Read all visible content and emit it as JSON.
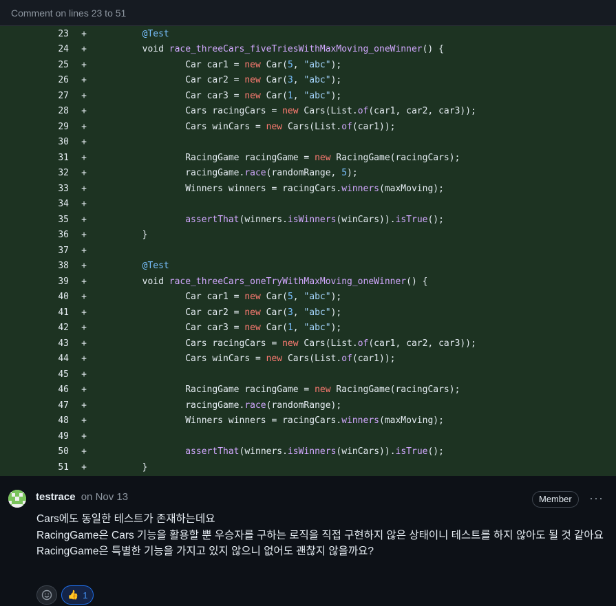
{
  "header": {
    "title": "Comment on lines 23 to 51"
  },
  "code": {
    "lines": [
      {
        "n": "23",
        "sign": "+",
        "tokens": [
          [
            "        ",
            ""
          ],
          [
            "@Test",
            "an"
          ]
        ]
      },
      {
        "n": "24",
        "sign": "+",
        "tokens": [
          [
            "        void ",
            ""
          ],
          [
            "race_threeCars_fiveTriesWithMaxMoving_oneWinner",
            "fn"
          ],
          [
            "() {",
            ""
          ]
        ]
      },
      {
        "n": "25",
        "sign": "+",
        "tokens": [
          [
            "                Car car1 = ",
            ""
          ],
          [
            "new",
            "kw"
          ],
          [
            " Car(",
            ""
          ],
          [
            "5",
            "num"
          ],
          [
            ", ",
            ""
          ],
          [
            "\"abc\"",
            "str"
          ],
          [
            ");",
            ""
          ]
        ]
      },
      {
        "n": "26",
        "sign": "+",
        "tokens": [
          [
            "                Car car2 = ",
            ""
          ],
          [
            "new",
            "kw"
          ],
          [
            " Car(",
            ""
          ],
          [
            "3",
            "num"
          ],
          [
            ", ",
            ""
          ],
          [
            "\"abc\"",
            "str"
          ],
          [
            ");",
            ""
          ]
        ]
      },
      {
        "n": "27",
        "sign": "+",
        "tokens": [
          [
            "                Car car3 = ",
            ""
          ],
          [
            "new",
            "kw"
          ],
          [
            " Car(",
            ""
          ],
          [
            "1",
            "num"
          ],
          [
            ", ",
            ""
          ],
          [
            "\"abc\"",
            "str"
          ],
          [
            ");",
            ""
          ]
        ]
      },
      {
        "n": "28",
        "sign": "+",
        "tokens": [
          [
            "                Cars racingCars = ",
            ""
          ],
          [
            "new",
            "kw"
          ],
          [
            " Cars(List.",
            ""
          ],
          [
            "of",
            "fn"
          ],
          [
            "(car1, car2, car3));",
            ""
          ]
        ]
      },
      {
        "n": "29",
        "sign": "+",
        "tokens": [
          [
            "                Cars winCars = ",
            ""
          ],
          [
            "new",
            "kw"
          ],
          [
            " Cars(List.",
            ""
          ],
          [
            "of",
            "fn"
          ],
          [
            "(car1));",
            ""
          ]
        ]
      },
      {
        "n": "30",
        "sign": "+",
        "tokens": []
      },
      {
        "n": "31",
        "sign": "+",
        "tokens": [
          [
            "                RacingGame racingGame = ",
            ""
          ],
          [
            "new",
            "kw"
          ],
          [
            " RacingGame(racingCars);",
            ""
          ]
        ]
      },
      {
        "n": "32",
        "sign": "+",
        "tokens": [
          [
            "                racingGame.",
            ""
          ],
          [
            "race",
            "fn"
          ],
          [
            "(randomRange, ",
            ""
          ],
          [
            "5",
            "num"
          ],
          [
            ");",
            ""
          ]
        ]
      },
      {
        "n": "33",
        "sign": "+",
        "tokens": [
          [
            "                Winners winners = racingCars.",
            ""
          ],
          [
            "winners",
            "fn"
          ],
          [
            "(maxMoving);",
            ""
          ]
        ]
      },
      {
        "n": "34",
        "sign": "+",
        "tokens": []
      },
      {
        "n": "35",
        "sign": "+",
        "tokens": [
          [
            "                ",
            ""
          ],
          [
            "assertThat",
            "fn"
          ],
          [
            "(winners.",
            ""
          ],
          [
            "isWinners",
            "fn"
          ],
          [
            "(winCars)).",
            ""
          ],
          [
            "isTrue",
            "fn"
          ],
          [
            "();",
            ""
          ]
        ]
      },
      {
        "n": "36",
        "sign": "+",
        "tokens": [
          [
            "        }",
            ""
          ]
        ]
      },
      {
        "n": "37",
        "sign": "+",
        "tokens": []
      },
      {
        "n": "38",
        "sign": "+",
        "tokens": [
          [
            "        ",
            ""
          ],
          [
            "@Test",
            "an"
          ]
        ]
      },
      {
        "n": "39",
        "sign": "+",
        "tokens": [
          [
            "        void ",
            ""
          ],
          [
            "race_threeCars_oneTryWithMaxMoving_oneWinner",
            "fn"
          ],
          [
            "() {",
            ""
          ]
        ]
      },
      {
        "n": "40",
        "sign": "+",
        "tokens": [
          [
            "                Car car1 = ",
            ""
          ],
          [
            "new",
            "kw"
          ],
          [
            " Car(",
            ""
          ],
          [
            "5",
            "num"
          ],
          [
            ", ",
            ""
          ],
          [
            "\"abc\"",
            "str"
          ],
          [
            ");",
            ""
          ]
        ]
      },
      {
        "n": "41",
        "sign": "+",
        "tokens": [
          [
            "                Car car2 = ",
            ""
          ],
          [
            "new",
            "kw"
          ],
          [
            " Car(",
            ""
          ],
          [
            "3",
            "num"
          ],
          [
            ", ",
            ""
          ],
          [
            "\"abc\"",
            "str"
          ],
          [
            ");",
            ""
          ]
        ]
      },
      {
        "n": "42",
        "sign": "+",
        "tokens": [
          [
            "                Car car3 = ",
            ""
          ],
          [
            "new",
            "kw"
          ],
          [
            " Car(",
            ""
          ],
          [
            "1",
            "num"
          ],
          [
            ", ",
            ""
          ],
          [
            "\"abc\"",
            "str"
          ],
          [
            ");",
            ""
          ]
        ]
      },
      {
        "n": "43",
        "sign": "+",
        "tokens": [
          [
            "                Cars racingCars = ",
            ""
          ],
          [
            "new",
            "kw"
          ],
          [
            " Cars(List.",
            ""
          ],
          [
            "of",
            "fn"
          ],
          [
            "(car1, car2, car3));",
            ""
          ]
        ]
      },
      {
        "n": "44",
        "sign": "+",
        "tokens": [
          [
            "                Cars winCars = ",
            ""
          ],
          [
            "new",
            "kw"
          ],
          [
            " Cars(List.",
            ""
          ],
          [
            "of",
            "fn"
          ],
          [
            "(car1));",
            ""
          ]
        ]
      },
      {
        "n": "45",
        "sign": "+",
        "tokens": []
      },
      {
        "n": "46",
        "sign": "+",
        "tokens": [
          [
            "                RacingGame racingGame = ",
            ""
          ],
          [
            "new",
            "kw"
          ],
          [
            " RacingGame(racingCars);",
            ""
          ]
        ]
      },
      {
        "n": "47",
        "sign": "+",
        "tokens": [
          [
            "                racingGame.",
            ""
          ],
          [
            "race",
            "fn"
          ],
          [
            "(randomRange);",
            ""
          ]
        ]
      },
      {
        "n": "48",
        "sign": "+",
        "tokens": [
          [
            "                Winners winners = racingCars.",
            ""
          ],
          [
            "winners",
            "fn"
          ],
          [
            "(maxMoving);",
            ""
          ]
        ]
      },
      {
        "n": "49",
        "sign": "+",
        "tokens": []
      },
      {
        "n": "50",
        "sign": "+",
        "tokens": [
          [
            "                ",
            ""
          ],
          [
            "assertThat",
            "fn"
          ],
          [
            "(winners.",
            ""
          ],
          [
            "isWinners",
            "fn"
          ],
          [
            "(winCars)).",
            ""
          ],
          [
            "isTrue",
            "fn"
          ],
          [
            "();",
            ""
          ]
        ]
      },
      {
        "n": "51",
        "sign": "+",
        "tokens": [
          [
            "        }",
            ""
          ]
        ]
      }
    ]
  },
  "comment": {
    "author": "testrace",
    "date": "on Nov 13",
    "badge": "Member",
    "more": "···",
    "body": [
      "Cars에도 동일한 테스트가 존재하는데요",
      "RacingGame은 Cars 기능을 활용할 뿐 우승자를 구하는 로직을 직접 구현하지 않은 상태이니 테스트를 하지 않아도 될 것 같아요",
      "RacingGame은 특별한 기능을 가지고 있지 않으니 없어도 괜찮지 않을까요?"
    ],
    "reactions": {
      "emoji_icon": "smiley-icon",
      "thumb_icon": "👍",
      "thumb_count": "1"
    }
  },
  "colors": {
    "added_bg": "#1d3322",
    "page_bg": "#0d1117",
    "accent": "#1f6feb"
  }
}
